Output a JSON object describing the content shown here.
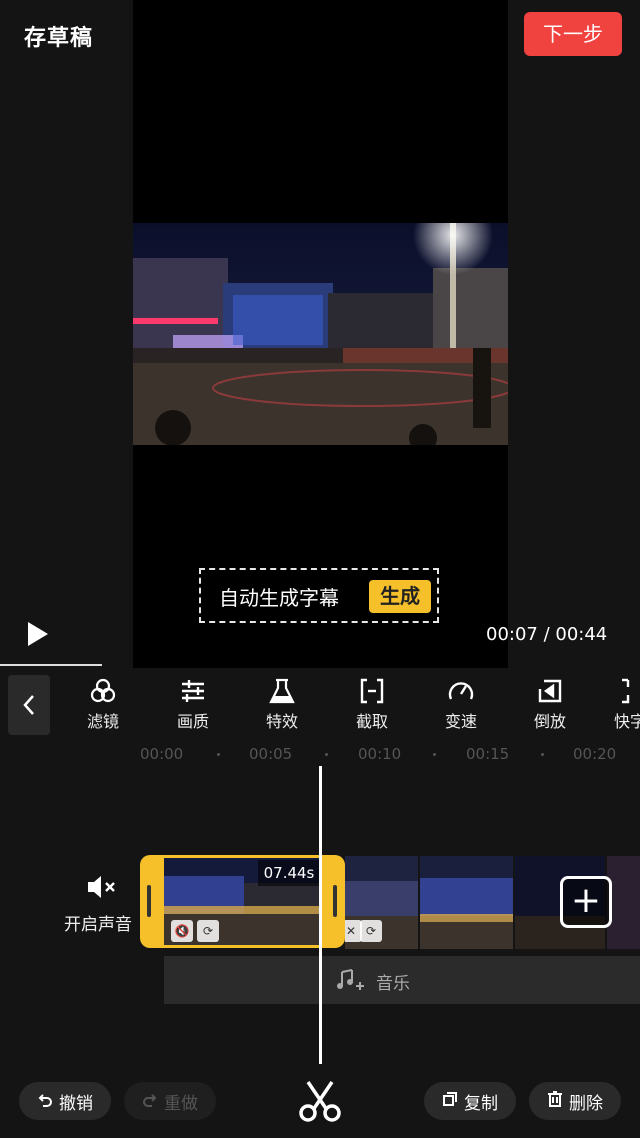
{
  "header": {
    "draft_label": "存草稿",
    "next_label": "下一步"
  },
  "preview": {
    "subtitle_text": "自动生成字幕",
    "generate_label": "生成",
    "time_current": "00:07",
    "time_sep": " / ",
    "time_total": "00:44",
    "progress": 0.159
  },
  "toolbar": {
    "items": [
      {
        "label": "滤镜",
        "icon": "filter-icon"
      },
      {
        "label": "画质",
        "icon": "sliders-icon"
      },
      {
        "label": "特效",
        "icon": "flask-icon"
      },
      {
        "label": "截取",
        "icon": "trim-icon"
      },
      {
        "label": "变速",
        "icon": "speed-icon"
      },
      {
        "label": "倒放",
        "icon": "reverse-icon"
      },
      {
        "label": "快字",
        "icon": "quick-text-icon"
      }
    ]
  },
  "timeline": {
    "ticks": [
      "00:00",
      "00:05",
      "00:10",
      "00:15",
      "00:20"
    ],
    "mute_label": "开启声音",
    "clip_duration": "07.44s",
    "music_label": "音乐"
  },
  "bottom": {
    "undo_label": "撤销",
    "redo_label": "重做",
    "copy_label": "复制",
    "delete_label": "删除"
  },
  "colors": {
    "accent_red": "#f0423f",
    "accent_yellow": "#f5c02a",
    "background": "#141414"
  }
}
